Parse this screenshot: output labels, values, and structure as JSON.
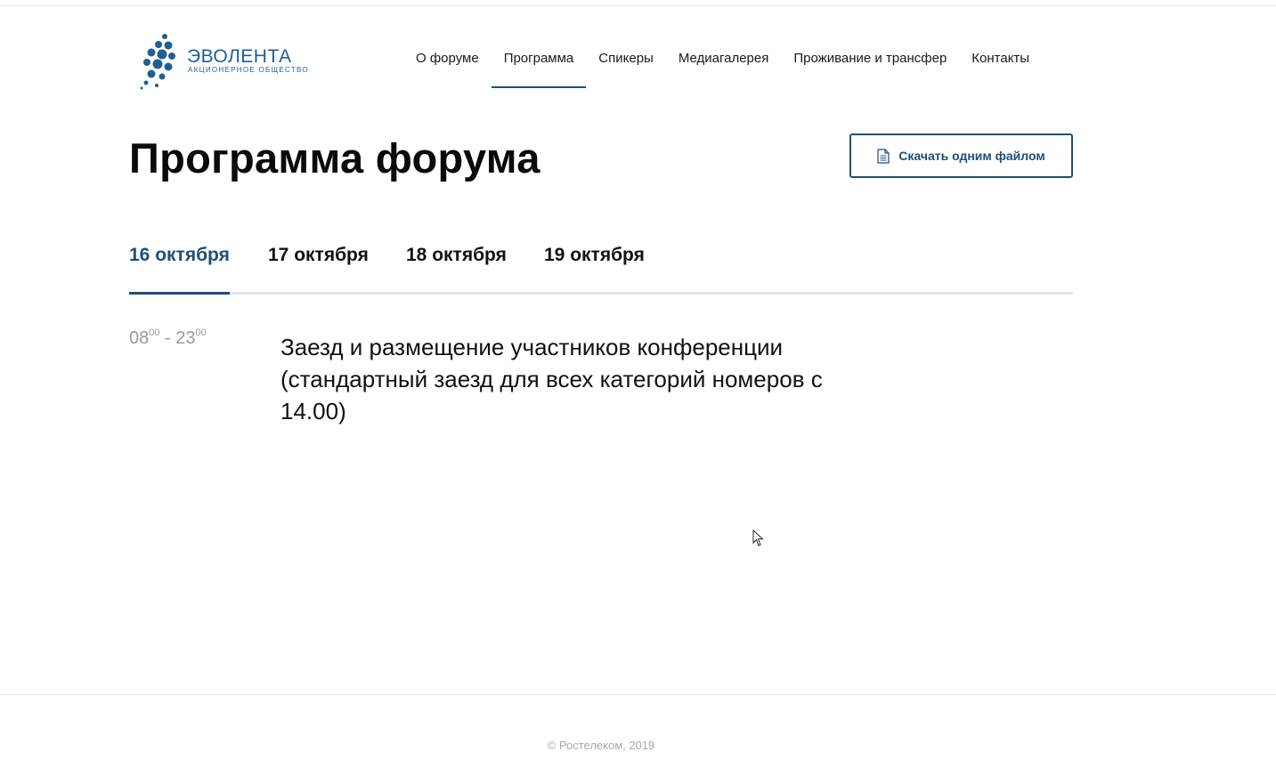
{
  "logo": {
    "title": "ЭВОЛЕНТА",
    "subtitle": "АКЦИОНЕРНОЕ ОБЩЕСТВО",
    "brand_color": "#1f5f96"
  },
  "nav": {
    "items": [
      {
        "label": "О форуме",
        "active": false
      },
      {
        "label": "Программа",
        "active": true
      },
      {
        "label": "Спикеры",
        "active": false
      },
      {
        "label": "Медиагалерея",
        "active": false
      },
      {
        "label": "Проживание и трансфер",
        "active": false
      },
      {
        "label": "Контакты",
        "active": false
      }
    ]
  },
  "page": {
    "title": "Программа форума",
    "download_label": "Скачать одним файлом",
    "download_icon": "document-icon"
  },
  "tabs": [
    {
      "label": "16 октября",
      "active": true
    },
    {
      "label": "17 октября",
      "active": false
    },
    {
      "label": "18 октября",
      "active": false
    },
    {
      "label": "19 октября",
      "active": false
    }
  ],
  "schedule": [
    {
      "start_hour": "08",
      "start_min": "00",
      "separator": " - ",
      "end_hour": "23",
      "end_min": "00",
      "title": "Заезд и размещение участников конференции (стандартный заезд для всех категорий номеров с 14.00)"
    }
  ],
  "footer": {
    "copyright": "© Ростелеком, 2019"
  },
  "colors": {
    "accent": "#1f4e79",
    "muted_text": "#9a9a9a"
  }
}
